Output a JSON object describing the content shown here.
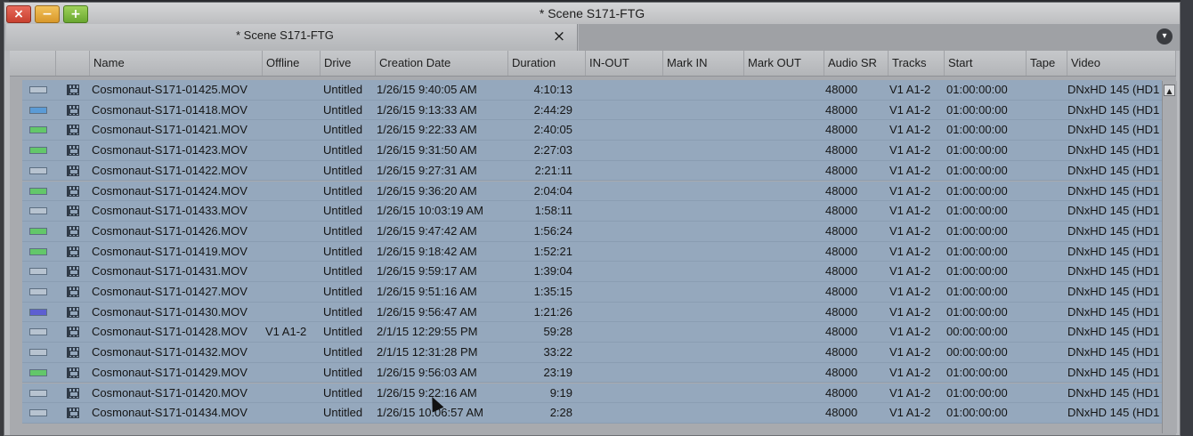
{
  "window": {
    "title": "* Scene S171-FTG",
    "close_glyph": "×",
    "minimize_glyph": "−",
    "maximize_glyph": "+"
  },
  "tab": {
    "label": "* Scene S171-FTG",
    "close_glyph": "×",
    "menu_glyph": "▾"
  },
  "columns": [
    {
      "key": "color",
      "label": ""
    },
    {
      "key": "icon",
      "label": ""
    },
    {
      "key": "name",
      "label": "Name"
    },
    {
      "key": "offline",
      "label": "Offline"
    },
    {
      "key": "drive",
      "label": "Drive"
    },
    {
      "key": "created",
      "label": "Creation Date"
    },
    {
      "key": "duration",
      "label": "Duration"
    },
    {
      "key": "inout",
      "label": "IN-OUT"
    },
    {
      "key": "markin",
      "label": "Mark IN"
    },
    {
      "key": "markout",
      "label": "Mark OUT"
    },
    {
      "key": "audiosr",
      "label": "Audio SR"
    },
    {
      "key": "tracks",
      "label": "Tracks"
    },
    {
      "key": "start",
      "label": "Start"
    },
    {
      "key": "tape",
      "label": "Tape"
    },
    {
      "key": "video",
      "label": "Video"
    }
  ],
  "colors": {
    "none": "#b7c3d0",
    "blue": "#5b9bd6",
    "green": "#63c76a",
    "purple": "#5d5fd1"
  },
  "rows": [
    {
      "color": "none",
      "name": "Cosmonaut-S171-01425.MOV",
      "offline": "",
      "drive": "Untitled",
      "created": "1/26/15 9:40:05 AM",
      "duration": "4:10:13",
      "audiosr": "48000",
      "tracks": "V1 A1-2",
      "start": "01:00:00:00",
      "video": "DNxHD 145 (HD1"
    },
    {
      "color": "blue",
      "name": "Cosmonaut-S171-01418.MOV",
      "offline": "",
      "drive": "Untitled",
      "created": "1/26/15 9:13:33 AM",
      "duration": "2:44:29",
      "audiosr": "48000",
      "tracks": "V1 A1-2",
      "start": "01:00:00:00",
      "video": "DNxHD 145 (HD1"
    },
    {
      "color": "green",
      "name": "Cosmonaut-S171-01421.MOV",
      "offline": "",
      "drive": "Untitled",
      "created": "1/26/15 9:22:33 AM",
      "duration": "2:40:05",
      "audiosr": "48000",
      "tracks": "V1 A1-2",
      "start": "01:00:00:00",
      "video": "DNxHD 145 (HD1"
    },
    {
      "color": "green",
      "name": "Cosmonaut-S171-01423.MOV",
      "offline": "",
      "drive": "Untitled",
      "created": "1/26/15 9:31:50 AM",
      "duration": "2:27:03",
      "audiosr": "48000",
      "tracks": "V1 A1-2",
      "start": "01:00:00:00",
      "video": "DNxHD 145 (HD1"
    },
    {
      "color": "none",
      "name": "Cosmonaut-S171-01422.MOV",
      "offline": "",
      "drive": "Untitled",
      "created": "1/26/15 9:27:31 AM",
      "duration": "2:21:11",
      "audiosr": "48000",
      "tracks": "V1 A1-2",
      "start": "01:00:00:00",
      "video": "DNxHD 145 (HD1"
    },
    {
      "color": "green",
      "name": "Cosmonaut-S171-01424.MOV",
      "offline": "",
      "drive": "Untitled",
      "created": "1/26/15 9:36:20 AM",
      "duration": "2:04:04",
      "audiosr": "48000",
      "tracks": "V1 A1-2",
      "start": "01:00:00:00",
      "video": "DNxHD 145 (HD1"
    },
    {
      "color": "none",
      "name": "Cosmonaut-S171-01433.MOV",
      "offline": "",
      "drive": "Untitled",
      "created": "1/26/15 10:03:19 AM",
      "duration": "1:58:11",
      "audiosr": "48000",
      "tracks": "V1 A1-2",
      "start": "01:00:00:00",
      "video": "DNxHD 145 (HD1"
    },
    {
      "color": "green",
      "name": "Cosmonaut-S171-01426.MOV",
      "offline": "",
      "drive": "Untitled",
      "created": "1/26/15 9:47:42 AM",
      "duration": "1:56:24",
      "audiosr": "48000",
      "tracks": "V1 A1-2",
      "start": "01:00:00:00",
      "video": "DNxHD 145 (HD1"
    },
    {
      "color": "green",
      "name": "Cosmonaut-S171-01419.MOV",
      "offline": "",
      "drive": "Untitled",
      "created": "1/26/15 9:18:42 AM",
      "duration": "1:52:21",
      "audiosr": "48000",
      "tracks": "V1 A1-2",
      "start": "01:00:00:00",
      "video": "DNxHD 145 (HD1"
    },
    {
      "color": "none",
      "name": "Cosmonaut-S171-01431.MOV",
      "offline": "",
      "drive": "Untitled",
      "created": "1/26/15 9:59:17 AM",
      "duration": "1:39:04",
      "audiosr": "48000",
      "tracks": "V1 A1-2",
      "start": "01:00:00:00",
      "video": "DNxHD 145 (HD1"
    },
    {
      "color": "none",
      "name": "Cosmonaut-S171-01427.MOV",
      "offline": "",
      "drive": "Untitled",
      "created": "1/26/15 9:51:16 AM",
      "duration": "1:35:15",
      "audiosr": "48000",
      "tracks": "V1 A1-2",
      "start": "01:00:00:00",
      "video": "DNxHD 145 (HD1"
    },
    {
      "color": "purple",
      "name": "Cosmonaut-S171-01430.MOV",
      "offline": "",
      "drive": "Untitled",
      "created": "1/26/15 9:56:47 AM",
      "duration": "1:21:26",
      "audiosr": "48000",
      "tracks": "V1 A1-2",
      "start": "01:00:00:00",
      "video": "DNxHD 145 (HD1"
    },
    {
      "color": "none",
      "name": "Cosmonaut-S171-01428.MOV",
      "offline": "V1 A1-2",
      "drive": "Untitled",
      "created": "2/1/15 12:29:55 PM",
      "duration": "59:28",
      "audiosr": "48000",
      "tracks": "V1 A1-2",
      "start": "00:00:00:00",
      "video": "DNxHD 145 (HD1"
    },
    {
      "color": "none",
      "name": "Cosmonaut-S171-01432.MOV",
      "offline": "",
      "drive": "Untitled",
      "created": "2/1/15 12:31:28 PM",
      "duration": "33:22",
      "audiosr": "48000",
      "tracks": "V1 A1-2",
      "start": "00:00:00:00",
      "video": "DNxHD 145 (HD1"
    },
    {
      "color": "green",
      "name": "Cosmonaut-S171-01429.MOV",
      "offline": "",
      "drive": "Untitled",
      "created": "1/26/15 9:56:03 AM",
      "duration": "23:19",
      "audiosr": "48000",
      "tracks": "V1 A1-2",
      "start": "01:00:00:00",
      "video": "DNxHD 145 (HD1"
    },
    {
      "color": "none",
      "name": "Cosmonaut-S171-01420.MOV",
      "offline": "",
      "drive": "Untitled",
      "created": "1/26/15 9:22:16 AM",
      "duration": "9:19",
      "audiosr": "48000",
      "tracks": "V1 A1-2",
      "start": "01:00:00:00",
      "video": "DNxHD 145 (HD1"
    },
    {
      "color": "none",
      "name": "Cosmonaut-S171-01434.MOV",
      "offline": "",
      "drive": "Untitled",
      "created": "1/26/15 10:06:57 AM",
      "duration": "2:28",
      "audiosr": "48000",
      "tracks": "V1 A1-2",
      "start": "01:00:00:00",
      "video": "DNxHD 145 (HD1"
    }
  ],
  "scrollbar": {
    "up_glyph": "▲"
  }
}
